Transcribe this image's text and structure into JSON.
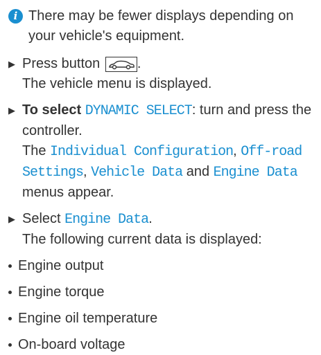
{
  "note": {
    "icon": "info-icon",
    "text": "There may be fewer displays depending on your vehicle's equipment."
  },
  "steps": [
    {
      "prefix": "Press button",
      "button_icon": "car-icon",
      "suffix": ".",
      "result": "The vehicle menu is displayed."
    },
    {
      "bold": "To select",
      "code": "DYNAMIC SELECT",
      "rest": ": turn and press the controller.",
      "result_pre": "The",
      "menus": [
        "Individual Configuration",
        "Off-road Settings",
        "Vehicle Data",
        "Engine Data"
      ],
      "sep1": ",",
      "sep2": ",",
      "sep3": "and",
      "result_post": "menus appear."
    },
    {
      "prefix": "Select",
      "code": "Engine Data",
      "suffix": ".",
      "result": "The following current data is displayed:"
    }
  ],
  "bullets": [
    "Engine output",
    "Engine torque",
    "Engine oil temperature",
    "On-board voltage"
  ],
  "colors": {
    "accent": "#1a8fd0",
    "text": "#333333"
  }
}
